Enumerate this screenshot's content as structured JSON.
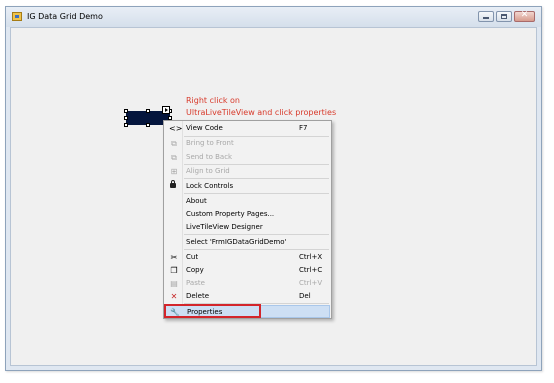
{
  "window": {
    "title": "IG Data Grid Demo"
  },
  "annotation": {
    "line1": "Right click on",
    "line2": "UltraLiveTileView  and click properties",
    "color": "#d83a2b"
  },
  "context_menu": {
    "view_code": {
      "label": "View Code",
      "shortcut": "F7",
      "icon": "code-icon"
    },
    "bring_to_front": {
      "label": "Bring to Front",
      "icon": "bring-to-front-icon"
    },
    "send_to_back": {
      "label": "Send to Back",
      "icon": "send-to-back-icon"
    },
    "align_to_grid": {
      "label": "Align to Grid",
      "icon": "align-to-grid-icon"
    },
    "lock_controls": {
      "label": "Lock Controls",
      "icon": "lock-icon"
    },
    "about": {
      "label": "About"
    },
    "custom_property_pages": {
      "label": "Custom Property Pages..."
    },
    "designer": {
      "label": "LiveTileView Designer"
    },
    "select_form": {
      "label": "Select 'FrmIGDataGridDemo'"
    },
    "cut": {
      "label": "Cut",
      "shortcut": "Ctrl+X",
      "icon": "scissors-icon"
    },
    "copy": {
      "label": "Copy",
      "shortcut": "Ctrl+C",
      "icon": "copy-icon"
    },
    "paste": {
      "label": "Paste",
      "shortcut": "Ctrl+V",
      "icon": "paste-icon"
    },
    "delete": {
      "label": "Delete",
      "shortcut": "Del",
      "icon": "delete-x-icon"
    },
    "properties": {
      "label": "Properties",
      "icon": "wrench-icon"
    }
  },
  "colors": {
    "highlight_box": "#d3252b",
    "control_fill": "#04153d",
    "menu_hover": "#cddff4"
  }
}
